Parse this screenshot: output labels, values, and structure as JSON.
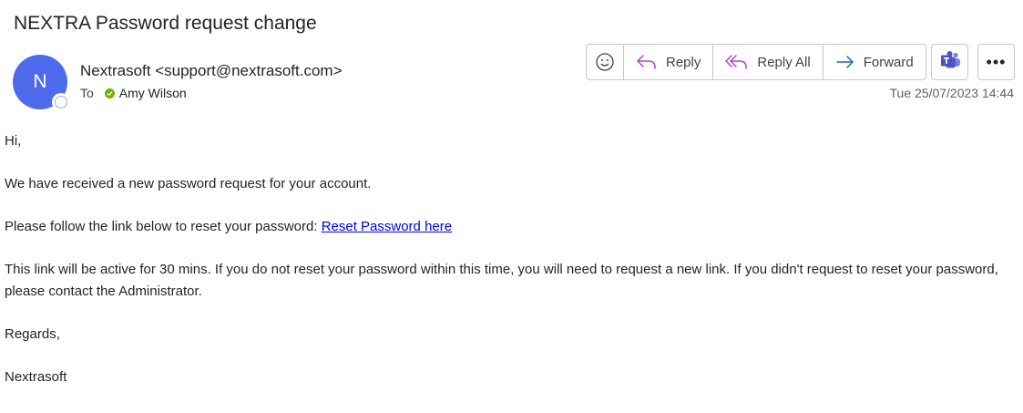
{
  "email": {
    "subject": "NEXTRA Password request change",
    "avatar_initial": "N",
    "sender": "Nextrasoft <support@nextrasoft.com>",
    "to_label": "To",
    "recipient": "Amy Wilson",
    "date": "Tue 25/07/2023 14:44"
  },
  "toolbar": {
    "emoji_icon": "emoji-smile-icon",
    "reply_label": "Reply",
    "reply_all_label": "Reply All",
    "forward_label": "Forward",
    "teams_icon": "teams-icon",
    "more_label": "•••"
  },
  "body": {
    "greeting": "Hi,",
    "line1": "We have received a new password request for your account.",
    "line2_prefix": "Please follow the link below to reset your password: ",
    "link_text": "Reset Password here",
    "line3": "This link will be active for 30 mins. If you do not reset your password within this time, you will need to request a new link. If you didn't request to reset your password, please contact the Administrator.",
    "closing": "Regards,",
    "signature": "Nextrasoft"
  },
  "colors": {
    "avatar": "#4f6bed",
    "presence_available": "#6bb700",
    "reply_icon": "#b146c2",
    "forward_icon": "#0f6cbd",
    "link": "#0000ee"
  }
}
